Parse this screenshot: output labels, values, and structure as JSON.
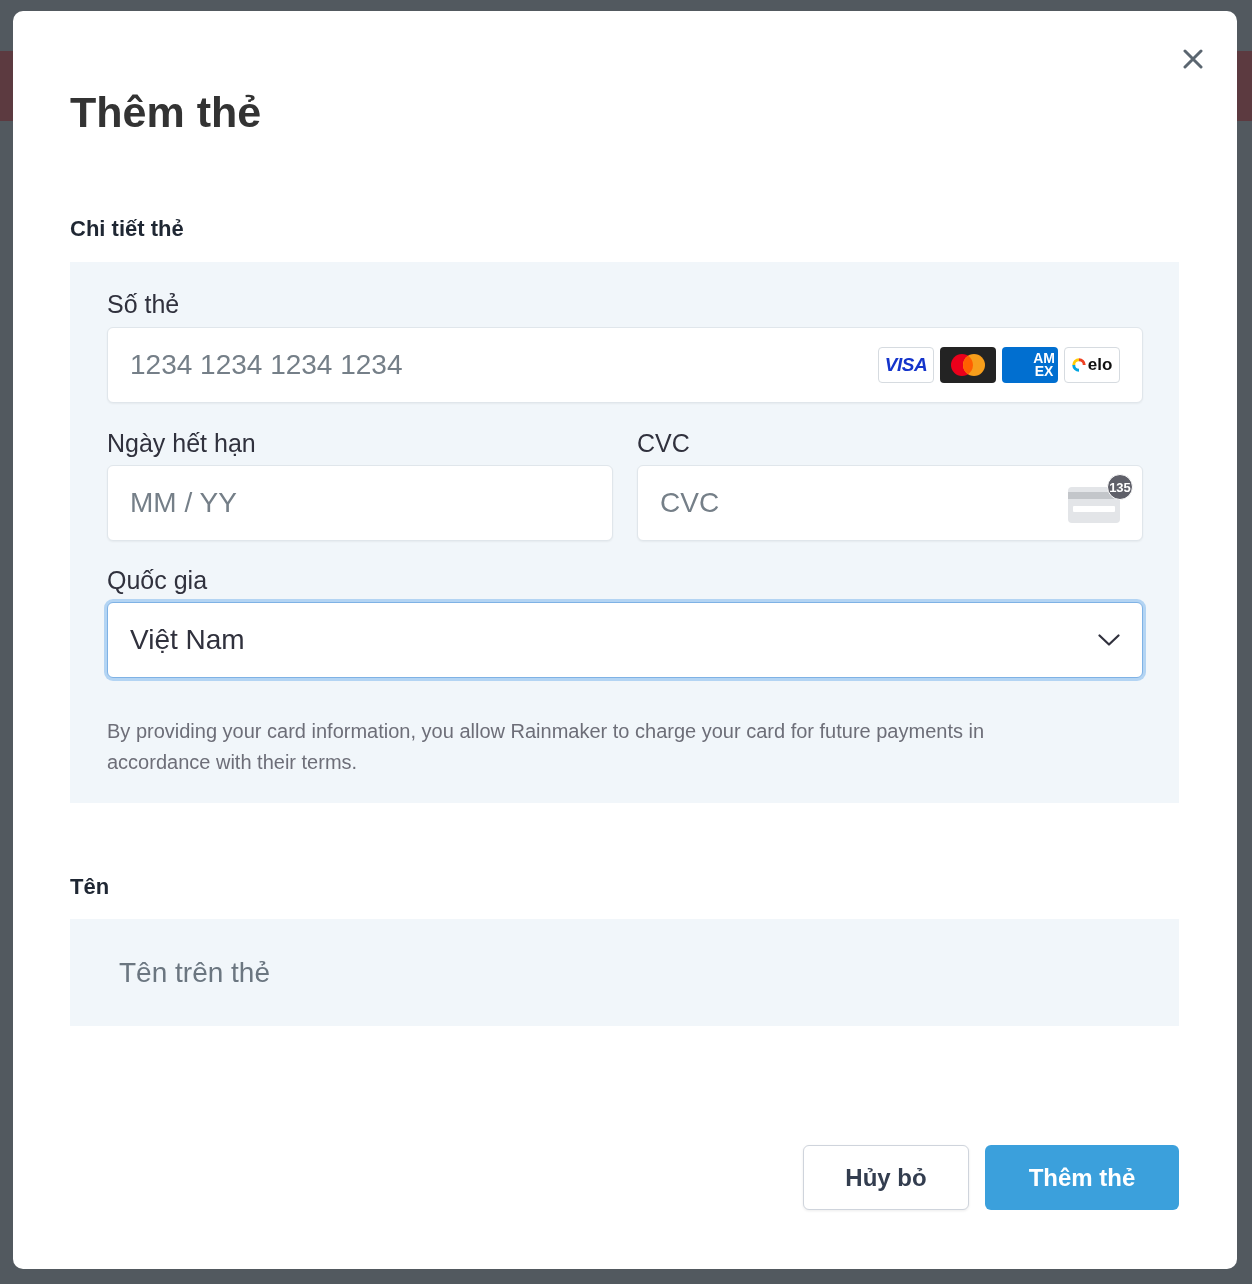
{
  "dialog": {
    "title": "Thêm thẻ"
  },
  "card_details": {
    "heading": "Chi tiết thẻ",
    "card_number": {
      "label": "Số thẻ",
      "placeholder": "1234 1234 1234 1234",
      "brands": [
        {
          "kind": "visa",
          "label": "VISA"
        },
        {
          "kind": "mastercard"
        },
        {
          "kind": "amex",
          "lines": [
            "AM",
            "EX"
          ]
        },
        {
          "kind": "elo",
          "label": "elo"
        }
      ]
    },
    "expiry": {
      "label": "Ngày hết hạn",
      "placeholder": "MM / YY"
    },
    "cvc": {
      "label": "CVC",
      "placeholder": "CVC",
      "hint_number": "135"
    },
    "country": {
      "label": "Quốc gia",
      "value": "Việt Nam",
      "focused": true
    },
    "disclaimer": "By providing your card information, you allow Rainmaker to charge your card for future payments in accordance with their terms."
  },
  "name_section": {
    "heading": "Tên",
    "placeholder": "Tên trên thẻ"
  },
  "buttons": [
    {
      "label": "Hủy bỏ",
      "kind": "secondary"
    },
    {
      "label": "Thêm thẻ",
      "kind": "primary"
    }
  ]
}
